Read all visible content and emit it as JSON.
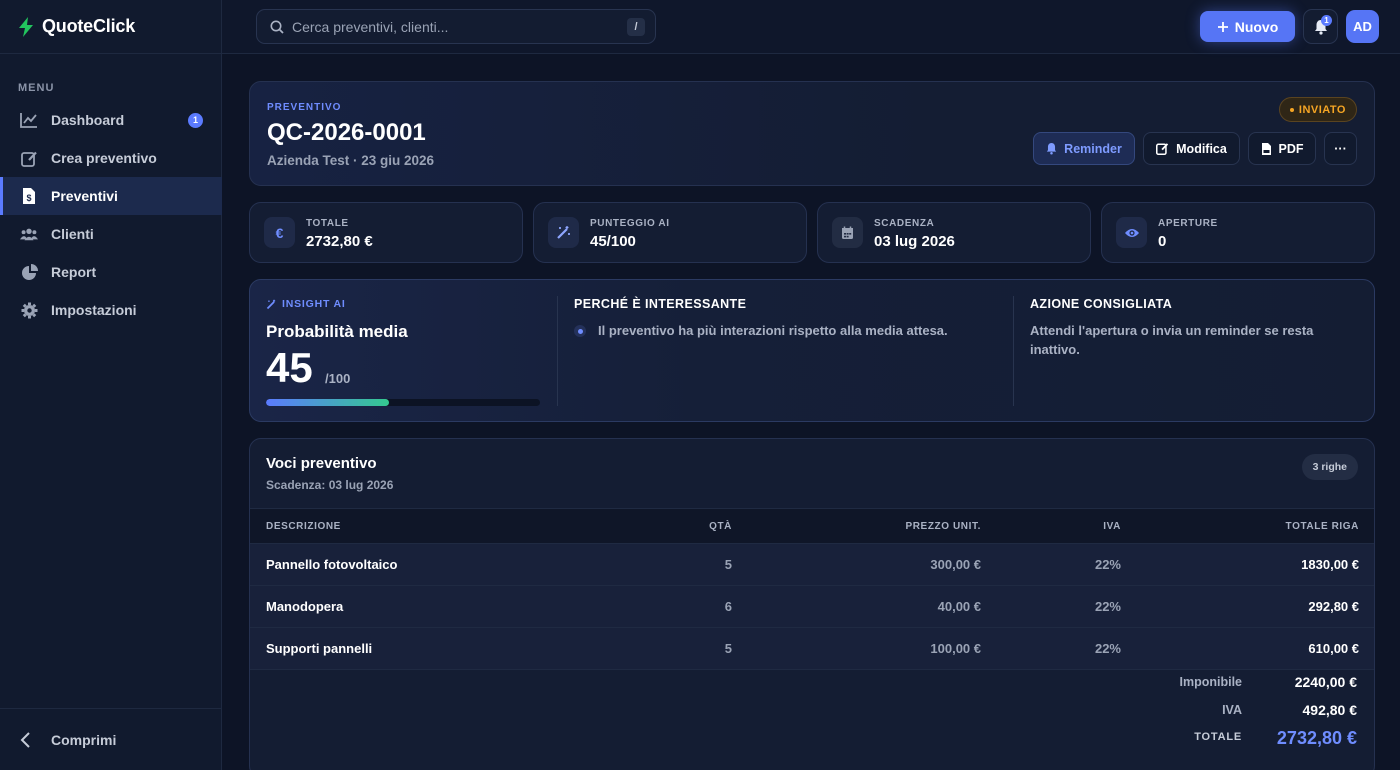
{
  "app": {
    "name": "QuoteClick"
  },
  "sidebar": {
    "menu_label": "MENU",
    "items": [
      {
        "label": "Dashboard",
        "badge": "1"
      },
      {
        "label": "Crea preventivo"
      },
      {
        "label": "Preventivi",
        "active": true
      },
      {
        "label": "Clienti"
      },
      {
        "label": "Report"
      },
      {
        "label": "Impostazioni"
      }
    ],
    "collapse_label": "Comprimi"
  },
  "topbar": {
    "search_placeholder": "Cerca preventivi, clienti...",
    "search_shortcut": "/",
    "new_button": "Nuovo",
    "notifications_count": "1",
    "avatar_initials": "AD"
  },
  "quote": {
    "kicker": "PREVENTIVO",
    "code": "QC-2026-0001",
    "subtitle": "Azienda Test · 23 giu 2026",
    "status": "INVIATO",
    "actions": {
      "reminder": "Reminder",
      "edit": "Modifica",
      "pdf": "PDF",
      "more": "···"
    }
  },
  "stats": [
    {
      "label": "TOTALE",
      "value": "2732,80 €",
      "icon": "euro-icon"
    },
    {
      "label": "PUNTEGGIO AI",
      "value": "45/100",
      "icon": "magic-wand-icon"
    },
    {
      "label": "SCADENZA",
      "value": "03 lug 2026",
      "icon": "calendar-icon"
    },
    {
      "label": "APERTURE",
      "value": "0",
      "icon": "eye-icon"
    }
  ],
  "insight": {
    "kicker": "INSIGHT AI",
    "title": "Probabilità media",
    "score": "45",
    "score_max": "/100",
    "score_fraction": 0.45,
    "why_title": "PERCHÉ È INTERESSANTE",
    "why_text": "Il preventivo ha più interazioni rispetto alla media attesa.",
    "action_title": "AZIONE CONSIGLIATA",
    "action_text": "Attendi l'apertura o invia un reminder se resta inattivo."
  },
  "items": {
    "title": "Voci preventivo",
    "subtitle": "Scadenza: 03 lug 2026",
    "rows_pill": "3 righe",
    "columns": {
      "description": "DESCRIZIONE",
      "qty": "QTÀ",
      "unit_price": "PREZZO UNIT.",
      "vat": "IVA",
      "row_total": "TOTALE RIGA"
    },
    "rows": [
      {
        "description": "Pannello fotovoltaico",
        "qty": "5",
        "unit_price": "300,00 €",
        "vat": "22%",
        "row_total": "1830,00 €"
      },
      {
        "description": "Manodopera",
        "qty": "6",
        "unit_price": "40,00 €",
        "vat": "22%",
        "row_total": "292,80 €"
      },
      {
        "description": "Supporti pannelli",
        "qty": "5",
        "unit_price": "100,00 €",
        "vat": "22%",
        "row_total": "610,00 €"
      }
    ],
    "totals": {
      "taxable_label": "Imponibile",
      "taxable": "2240,00 €",
      "vat_label": "IVA",
      "vat": "492,80 €",
      "total_label": "TOTALE",
      "total": "2732,80 €"
    }
  },
  "colors": {
    "accent": "#5675f5",
    "status_warning": "#f5a524",
    "success": "#22c55e"
  }
}
